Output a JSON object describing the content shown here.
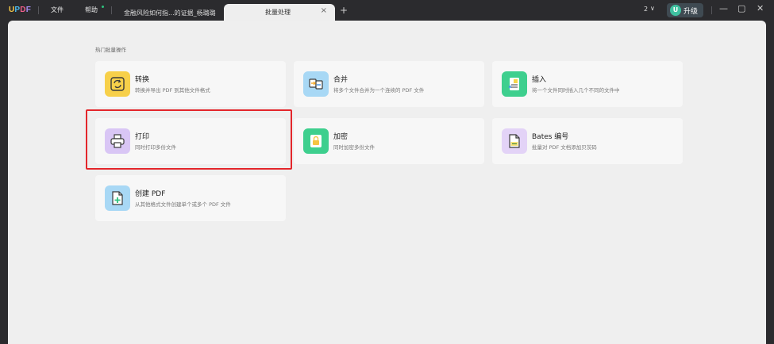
{
  "app": {
    "logo": {
      "u": "U",
      "p": "P",
      "d": "D",
      "f": "F"
    },
    "menu": {
      "file": "文件",
      "help": "帮助"
    }
  },
  "tabs": [
    {
      "label": "金融风险如何指...的证据_杨璐璐"
    },
    {
      "label": "批量处理",
      "close": "×"
    }
  ],
  "new_tab": "+",
  "toolbar": {
    "page_count": "2",
    "page_chevron": "∨",
    "avatar_letter": "U",
    "upgrade_label": "升级",
    "minimize": "—",
    "maximize": "▢",
    "close": "✕"
  },
  "section_title": "热门批量操作",
  "cards": [
    {
      "title": "转换",
      "desc": "转换并导出 PDF 到其他文件格式",
      "icon": "convert-icon",
      "color": "#f7d04a"
    },
    {
      "title": "合并",
      "desc": "将多个文件合并为一个连续的 PDF 文件",
      "icon": "merge-icon",
      "color": "#a8d8f5"
    },
    {
      "title": "插入",
      "desc": "将一个文件同时插入几个不同的文件中",
      "icon": "insert-icon",
      "color": "#3ecf8e"
    },
    {
      "title": "打印",
      "desc": "同时打印多份文件",
      "icon": "print-icon",
      "color": "#d9c6f5"
    },
    {
      "title": "加密",
      "desc": "同时加密多份文件",
      "icon": "lock-icon",
      "color": "#3ecf8e"
    },
    {
      "title": "Bates 编号",
      "desc": "批量对 PDF 文档添加贝茨码",
      "icon": "bates-number-icon",
      "color": "#e3d3f7"
    },
    {
      "title": "创建 PDF",
      "desc": "从其他格式文件创建单个或多个 PDF 文件",
      "icon": "create-pdf-icon",
      "color": "#a8d8f5"
    }
  ],
  "accent": "#e3262b"
}
